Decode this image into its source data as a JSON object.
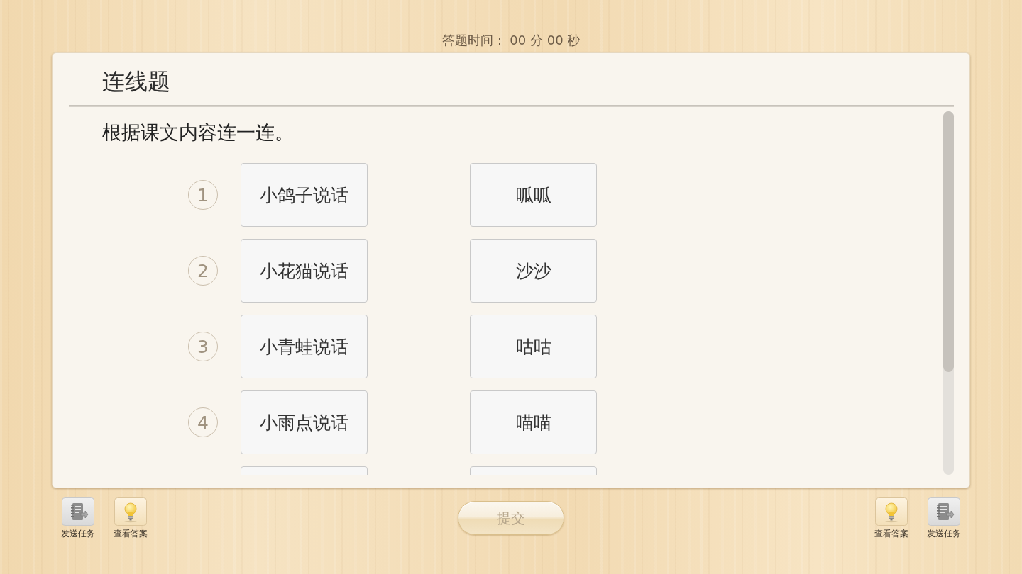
{
  "timer": "答题时间： 00 分 00 秒",
  "question": {
    "type_title": "连线题",
    "instruction": "根据课文内容连一连。",
    "pairs": [
      {
        "marker": "1",
        "left": "小鸽子说话",
        "right": "呱呱"
      },
      {
        "marker": "2",
        "left": "小花猫说话",
        "right": "沙沙"
      },
      {
        "marker": "3",
        "left": "小青蛙说话",
        "right": "咕咕"
      },
      {
        "marker": "4",
        "left": "小雨点说话",
        "right": "喵喵"
      }
    ],
    "more_rows_below": true
  },
  "toolbar": {
    "left": [
      {
        "kind": "send_task",
        "label": "发送任务"
      },
      {
        "kind": "view_answer",
        "label": "查看答案"
      }
    ],
    "submit": {
      "label": "提交",
      "disabled": true
    },
    "right": [
      {
        "kind": "view_answer",
        "label": "查看答案"
      },
      {
        "kind": "send_task",
        "label": "发送任务"
      }
    ]
  }
}
